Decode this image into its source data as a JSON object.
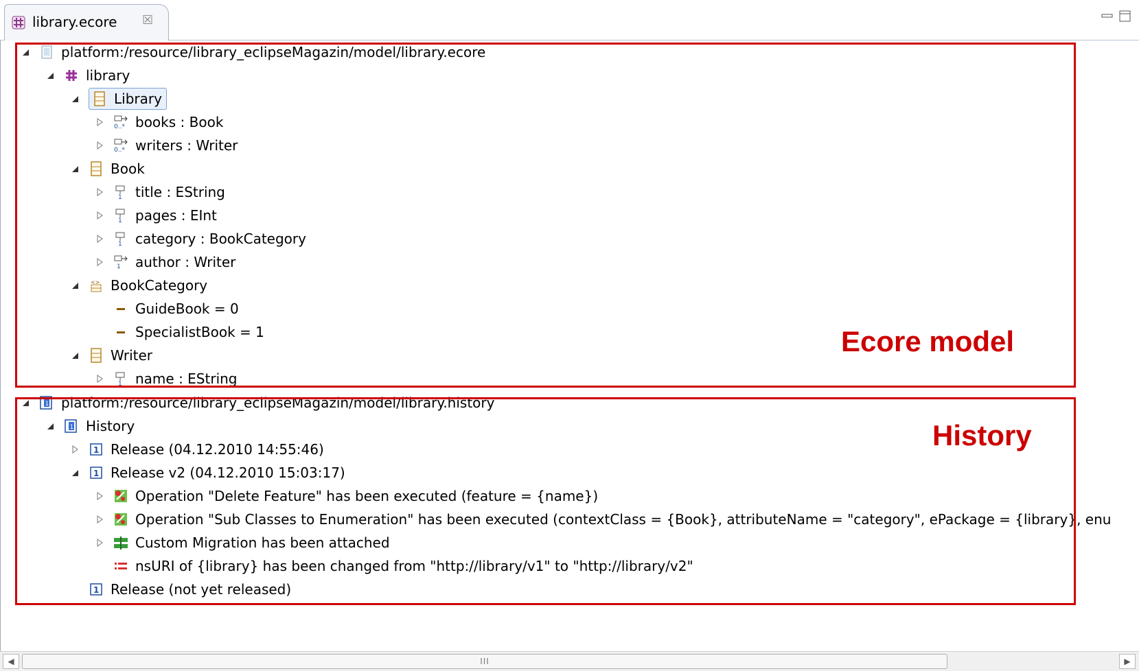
{
  "tab": {
    "label": "library.ecore",
    "close_symbol": "☒"
  },
  "tree": {
    "ecore_resource": "platform:/resource/library_eclipseMagazin/model/library.ecore",
    "package": "library",
    "class_library": "Library",
    "ref_books": "books : Book",
    "ref_writers": "writers : Writer",
    "class_book": "Book",
    "attr_title": "title : EString",
    "attr_pages": "pages : EInt",
    "attr_category": "category : BookCategory",
    "ref_author": "author : Writer",
    "enum_bookcategory": "BookCategory",
    "lit_guidebook": "GuideBook = 0",
    "lit_specialistbook": "SpecialistBook = 1",
    "class_writer": "Writer",
    "attr_name": "name : EString",
    "history_resource": "platform:/resource/library_eclipseMagazin/model/library.history",
    "history": "History",
    "release1": "Release (04.12.2010 14:55:46)",
    "release2": "Release v2 (04.12.2010 15:03:17)",
    "op_delete": "Operation \"Delete Feature\" has been executed (feature = {name})",
    "op_subclasses": "Operation \"Sub Classes to Enumeration\" has been executed (contextClass = {Book}, attributeName = \"category\", ePackage = {library}, enu",
    "custom_migration": "Custom Migration has been attached",
    "nsuri_change": "nsURI of {library} has been changed from \"http://library/v1\" to \"http://library/v2\"",
    "release_unreleased": "Release (not yet released)"
  },
  "annotations": {
    "ecore": "Ecore model",
    "history": "History"
  },
  "scrollbar": {
    "grip": "III"
  },
  "colors": {
    "highlight": "#cc0000",
    "selection": "#e8f1fb"
  }
}
